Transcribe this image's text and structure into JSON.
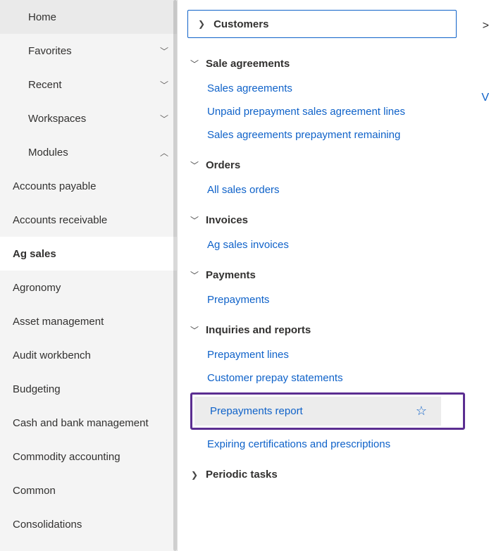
{
  "sidebar": {
    "nav": [
      {
        "label": "Home",
        "expandable": false
      },
      {
        "label": "Favorites",
        "expandable": true,
        "expanded": false
      },
      {
        "label": "Recent",
        "expandable": true,
        "expanded": false
      },
      {
        "label": "Workspaces",
        "expandable": true,
        "expanded": false
      },
      {
        "label": "Modules",
        "expandable": true,
        "expanded": true
      }
    ],
    "modules": [
      {
        "label": "Accounts payable",
        "selected": false
      },
      {
        "label": "Accounts receivable",
        "selected": false
      },
      {
        "label": "Ag sales",
        "selected": true
      },
      {
        "label": "Agronomy",
        "selected": false
      },
      {
        "label": "Asset management",
        "selected": false
      },
      {
        "label": "Audit workbench",
        "selected": false
      },
      {
        "label": "Budgeting",
        "selected": false
      },
      {
        "label": "Cash and bank management",
        "selected": false
      },
      {
        "label": "Commodity accounting",
        "selected": false
      },
      {
        "label": "Common",
        "selected": false
      },
      {
        "label": "Consolidations",
        "selected": false
      }
    ]
  },
  "content": {
    "top_selector": "Customers",
    "sections": [
      {
        "label": "Sale agreements",
        "expanded": true,
        "links": [
          "Sales agreements",
          "Unpaid prepayment sales agreement lines",
          "Sales agreements prepayment remaining"
        ]
      },
      {
        "label": "Orders",
        "expanded": true,
        "links": [
          "All sales orders"
        ]
      },
      {
        "label": "Invoices",
        "expanded": true,
        "links": [
          "Ag sales invoices"
        ]
      },
      {
        "label": "Payments",
        "expanded": true,
        "links": [
          "Prepayments"
        ]
      },
      {
        "label": "Inquiries and reports",
        "expanded": true,
        "links": [
          "Prepayment lines",
          "Customer prepay statements",
          "Prepayments report",
          "Expiring certifications and prescriptions"
        ],
        "highlighted_index": 2
      },
      {
        "label": "Periodic tasks",
        "expanded": false,
        "links": []
      }
    ],
    "edge_text_1": ">",
    "edge_text_2": "V"
  }
}
